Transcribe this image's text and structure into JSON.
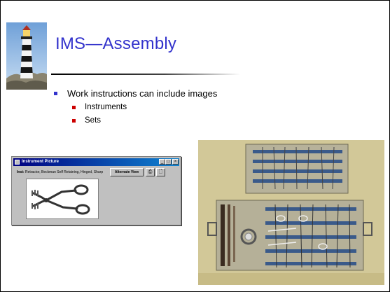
{
  "slide": {
    "title": "IMS—Assembly",
    "bullet": "Work instructions can include images",
    "subbullets": [
      "Instruments",
      "Sets"
    ]
  },
  "window": {
    "title": "Instrument Picture",
    "text_label": "Inst:",
    "text_value": "Retractor, Beckman Self Retaining, Hinged, Sharp",
    "alternate_view_label": "Alternate View",
    "print_icon": "printer-icon",
    "view_icon": "document-icon"
  },
  "colors": {
    "title": "#3333cc",
    "bullet_l1": "#3333cc",
    "bullet_l2": "#cc0000",
    "titlebar": "#000080"
  }
}
